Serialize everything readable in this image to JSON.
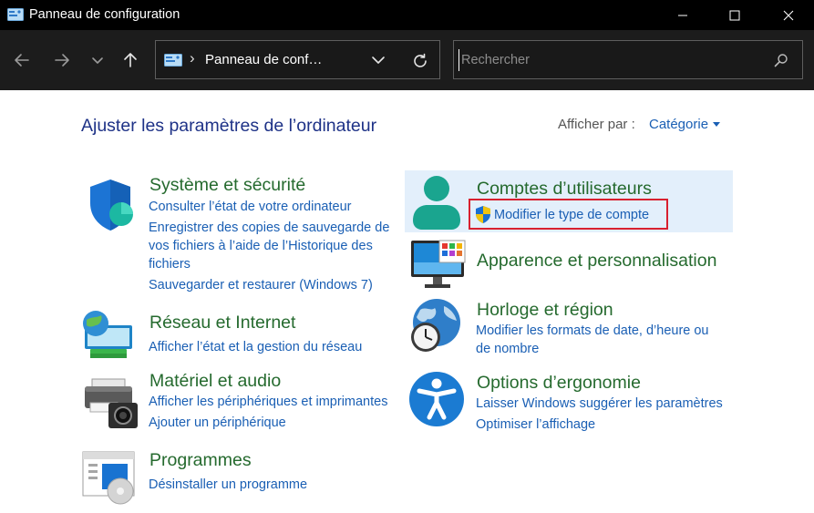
{
  "window": {
    "title": "Panneau de configuration"
  },
  "navigation": {
    "address_text": "Panneau de conf…",
    "search_placeholder": "Rechercher"
  },
  "main": {
    "heading": "Ajuster les paramètres de l’ordinateur",
    "view_by_label": "Afficher par :",
    "view_by_value": "Catégorie"
  },
  "categories": {
    "system": {
      "title": "Système et sécurité",
      "links": [
        "Consulter l’état de votre ordinateur",
        "Enregistrer des copies de sauvegarde de vos fichiers à l’aide de l’Historique des fichiers",
        "Sauvegarder et restaurer (Windows 7)"
      ]
    },
    "network": {
      "title": "Réseau et Internet",
      "links": [
        "Afficher l’état et la gestion du réseau"
      ]
    },
    "hardware": {
      "title": "Matériel et audio",
      "links": [
        "Afficher les périphériques et imprimantes",
        "Ajouter un périphérique"
      ]
    },
    "programs": {
      "title": "Programmes",
      "links": [
        "Désinstaller un programme"
      ]
    },
    "accounts": {
      "title": "Comptes d’utilisateurs",
      "links": [
        "Modifier le type de compte"
      ]
    },
    "appearance": {
      "title": "Apparence et personnalisation"
    },
    "clock": {
      "title": "Horloge et région",
      "links": [
        "Modifier les formats de date, d’heure ou de nombre"
      ]
    },
    "ease": {
      "title": "Options d’ergonomie",
      "links": [
        "Laisser Windows suggérer les paramètres",
        "Optimiser l’affichage"
      ]
    }
  },
  "colors": {
    "title_bar": "#000000",
    "nav_bar": "#1c1c1c",
    "heading": "#1e3287",
    "category_title": "#256a2e",
    "link": "#1a5fb4",
    "highlight_border": "#d8202f",
    "hover_background": "#e3effb"
  }
}
